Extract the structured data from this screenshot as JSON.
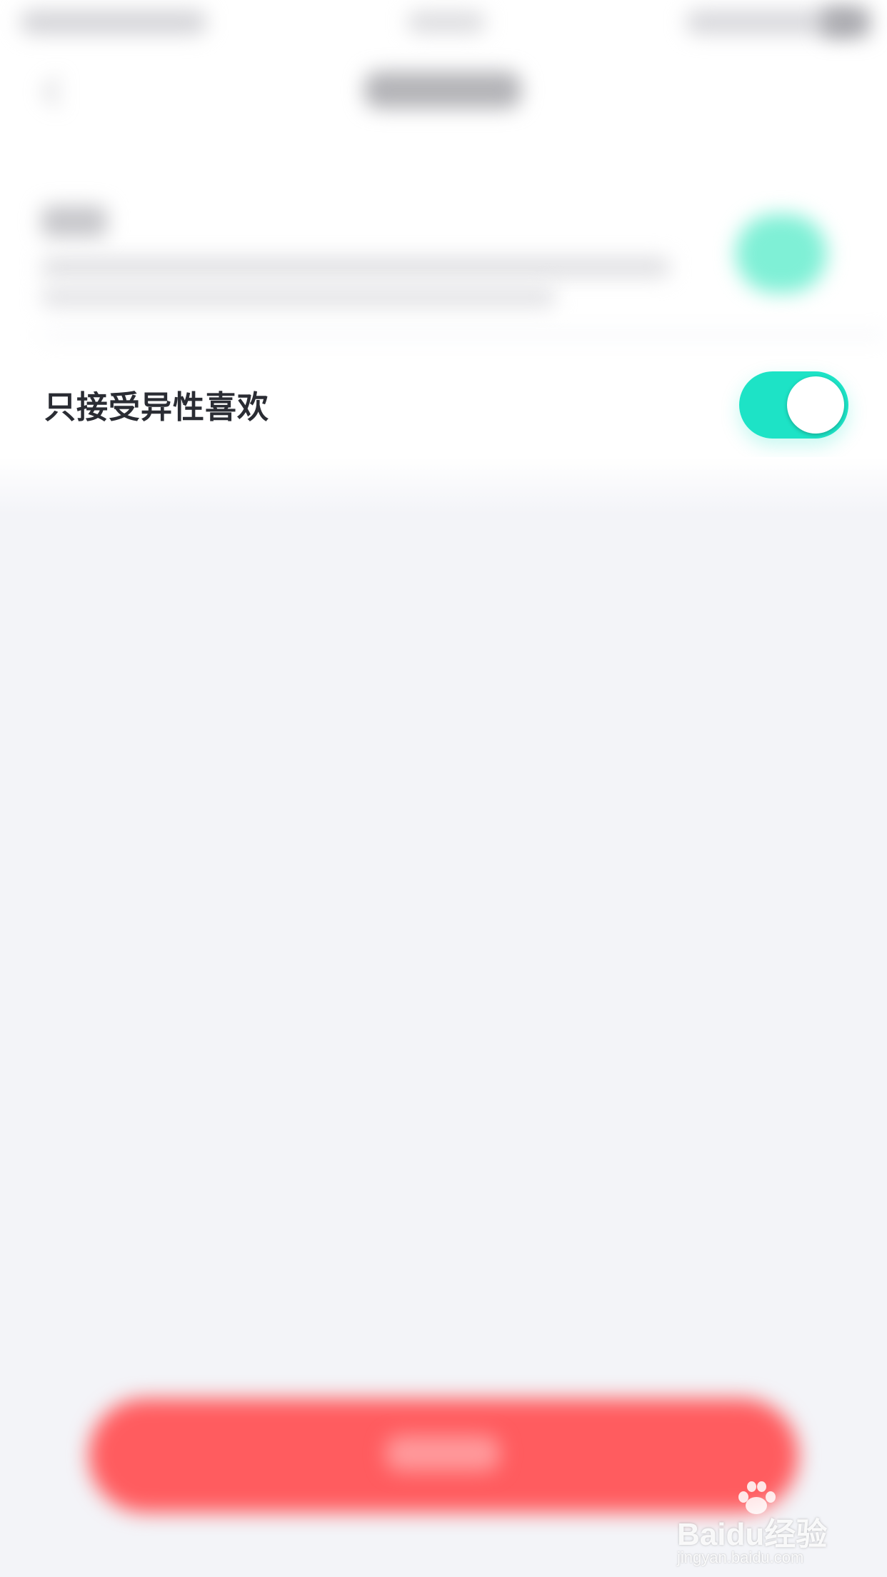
{
  "colors": {
    "accent": "#1de3c6",
    "primary_button": "#ff5c5f",
    "background": "#f3f4f8",
    "label_text": "#2a2c33"
  },
  "settings": {
    "opposite_sex_likes": {
      "label": "只接受异性喜欢",
      "enabled": true
    }
  },
  "watermark": {
    "logo": "Baidu经验",
    "url": "jingyan.baidu.com"
  },
  "icons": {
    "back": "chevron-left-icon",
    "battery": "battery-icon"
  }
}
